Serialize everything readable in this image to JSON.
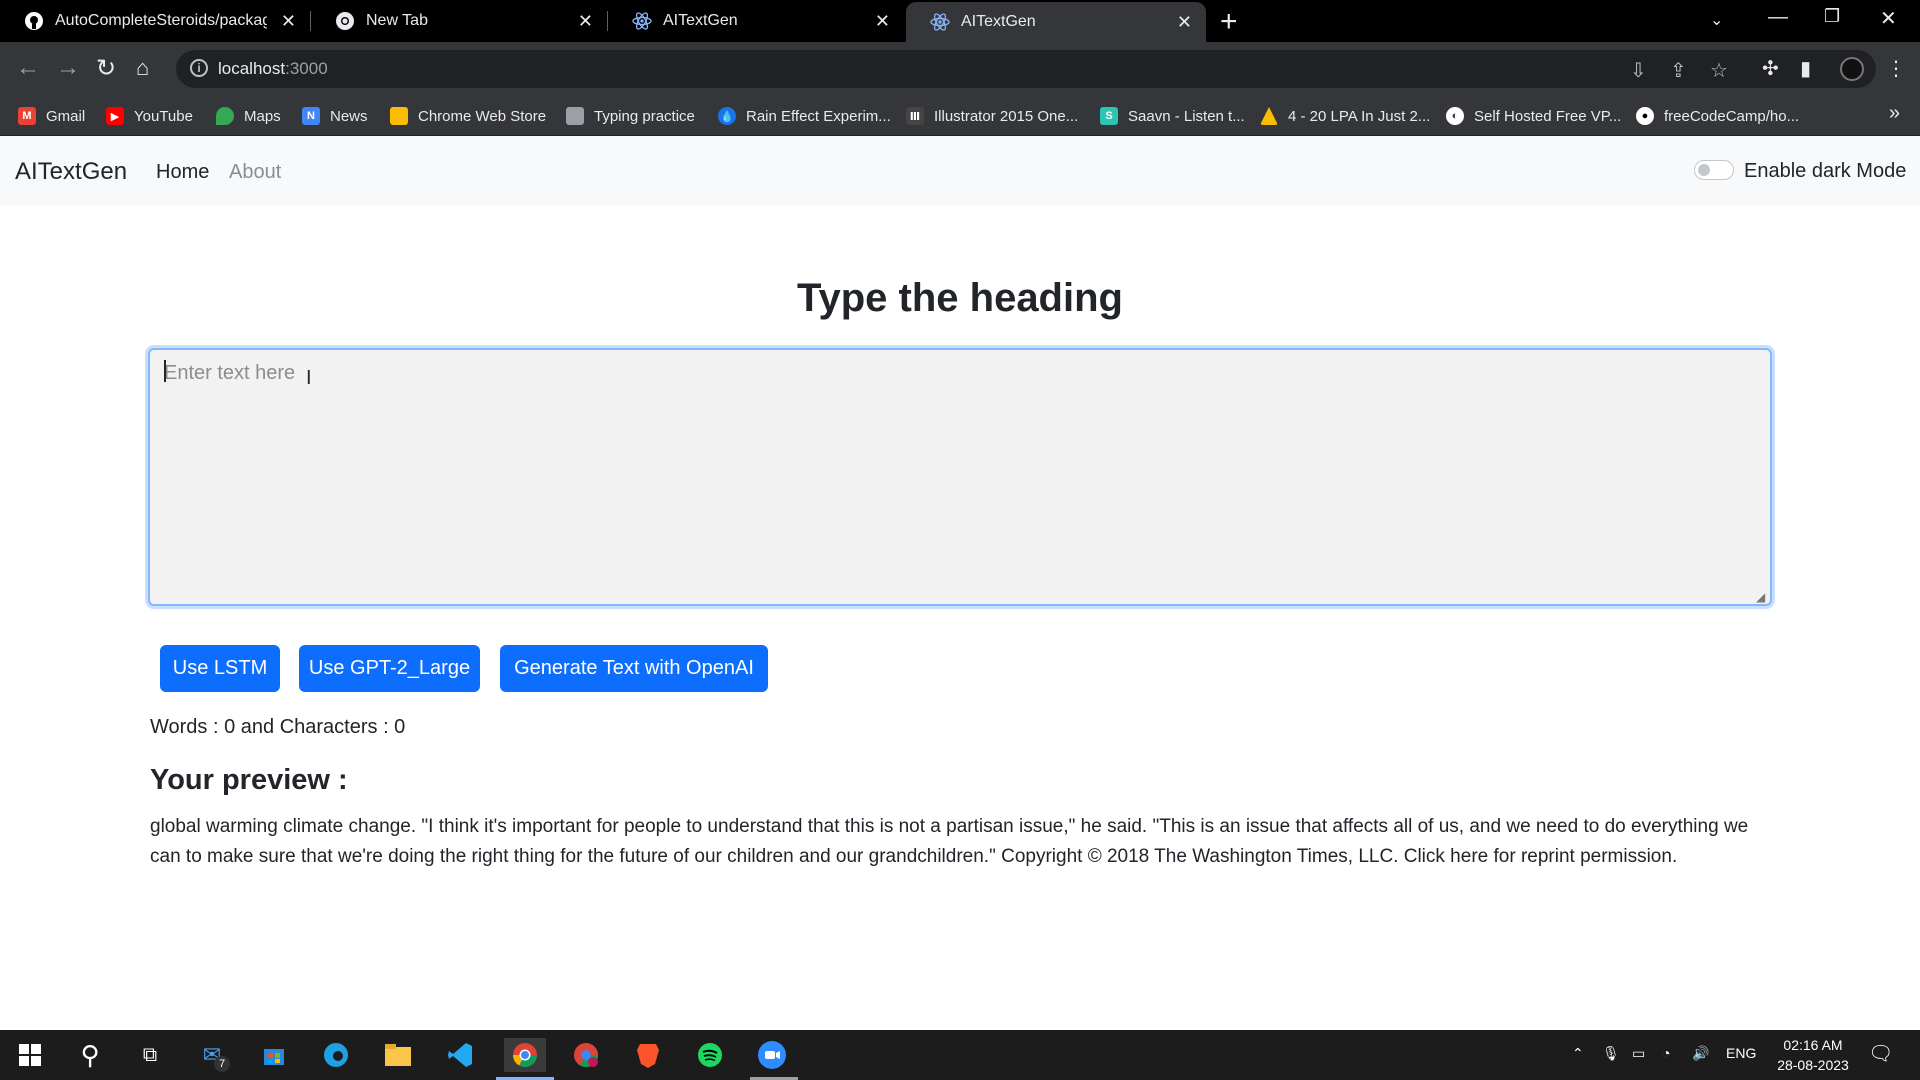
{
  "browser": {
    "tabs": [
      {
        "title": "AutoCompleteSteroids/package.j",
        "icon": "github-icon",
        "active": false
      },
      {
        "title": "New Tab",
        "icon": "chrome-icon",
        "active": false
      },
      {
        "title": "AITextGen",
        "icon": "react-icon",
        "active": false
      },
      {
        "title": "AITextGen",
        "icon": "react-icon",
        "active": true
      }
    ],
    "url_host": "localhost",
    "url_port": ":3000",
    "bookmarks": [
      {
        "label": "Gmail",
        "icon": "gmail-icon",
        "color": "#ea4335"
      },
      {
        "label": "YouTube",
        "icon": "youtube-icon",
        "color": "#ff0000"
      },
      {
        "label": "Maps",
        "icon": "maps-icon",
        "color": "#34a853"
      },
      {
        "label": "News",
        "icon": "news-icon",
        "color": "#4285f4"
      },
      {
        "label": "Chrome Web Store",
        "icon": "webstore-icon",
        "color": "#fbbc04"
      },
      {
        "label": "Typing practice",
        "icon": "typing-icon",
        "color": "#9aa0a6"
      },
      {
        "label": "Rain Effect Experim...",
        "icon": "rain-icon",
        "color": "#1a73e8"
      },
      {
        "label": "Illustrator 2015 One...",
        "icon": "illustrator-icon",
        "color": "#444444"
      },
      {
        "label": "Saavn - Listen t...",
        "icon": "saavn-icon",
        "color": "#2bc5b4"
      },
      {
        "label": "4 - 20 LPA In Just 2...",
        "icon": "drive-icon",
        "color": "#fbbc04"
      },
      {
        "label": "Self Hosted Free VP...",
        "icon": "globe-icon",
        "color": "#ffffff"
      },
      {
        "label": "freeCodeCamp/ho...",
        "icon": "github-icon",
        "color": "#ffffff"
      }
    ]
  },
  "app": {
    "brand": "AITextGen",
    "nav": {
      "home": "Home",
      "about": "About"
    },
    "dark_mode_label": "Enable dark Mode",
    "heading": "Type the heading",
    "textarea_placeholder": "Enter text here",
    "buttons": {
      "lstm": "Use LSTM",
      "gpt2": "Use GPT-2_Large",
      "openai": "Generate Text with OpenAI"
    },
    "counts": "Words : 0 and Characters : 0",
    "preview_title": "Your preview :",
    "preview_text": "global warming climate change. \"I think it's important for people to understand that this is not a partisan issue,\" he said. \"This is an issue that affects all of us, and we need to do everything we can to make sure that we're doing the right thing for the future of our children and our grandchildren.\" Copyright © 2018 The Washington Times, LLC. Click here for reprint permission."
  },
  "taskbar": {
    "mail_badge": "7",
    "language": "ENG",
    "time": "02:16 AM",
    "date": "28-08-2023"
  }
}
